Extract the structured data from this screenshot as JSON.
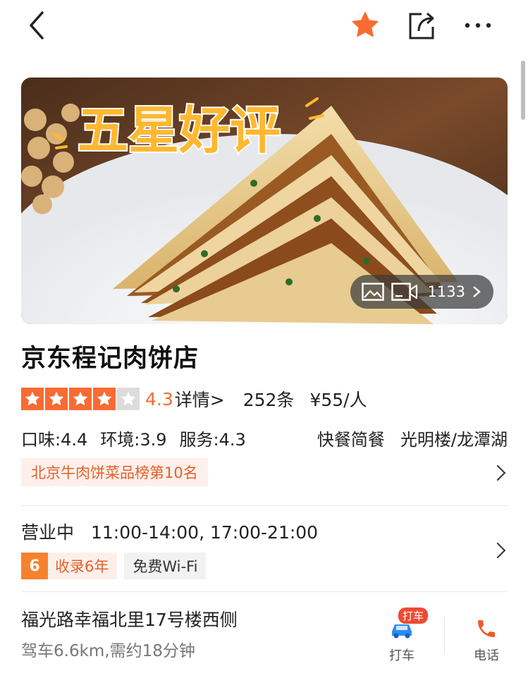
{
  "header": {
    "back_icon": "chevron-left-icon",
    "favorite_icon": "star-icon",
    "share_icon": "share-icon",
    "more_icon": "more-horizontal-icon",
    "accent_color": "#f86b33"
  },
  "hero": {
    "overlay_text": "五星好评",
    "media_count": "1133",
    "photo_icon": "image-icon",
    "video_icon": "video-camera-icon"
  },
  "shop": {
    "name": "京东程记肉饼店",
    "rating": {
      "stars": 4,
      "score": "4.3",
      "detail_label": "详情>",
      "review_count": "252条",
      "price_per_person": "¥55/人"
    },
    "scores": {
      "taste": "口味:4.4",
      "environment": "环境:3.9",
      "service": "服务:4.3"
    },
    "category": "快餐简餐",
    "area": "光明楼/龙潭湖",
    "rank_tag": "北京牛肉饼菜品榜第10名"
  },
  "hours": {
    "status": "营业中",
    "times": "11:00-14:00, 17:00-21:00",
    "years_badge": "6",
    "years_label": "收录6年",
    "wifi_label": "免费Wi-Fi"
  },
  "location": {
    "address": "福光路幸福北里17号楼西侧",
    "distance": "驾车6.6km,需约18分钟",
    "taxi_badge": "打车",
    "taxi_label": "打车",
    "phone_label": "电话"
  }
}
